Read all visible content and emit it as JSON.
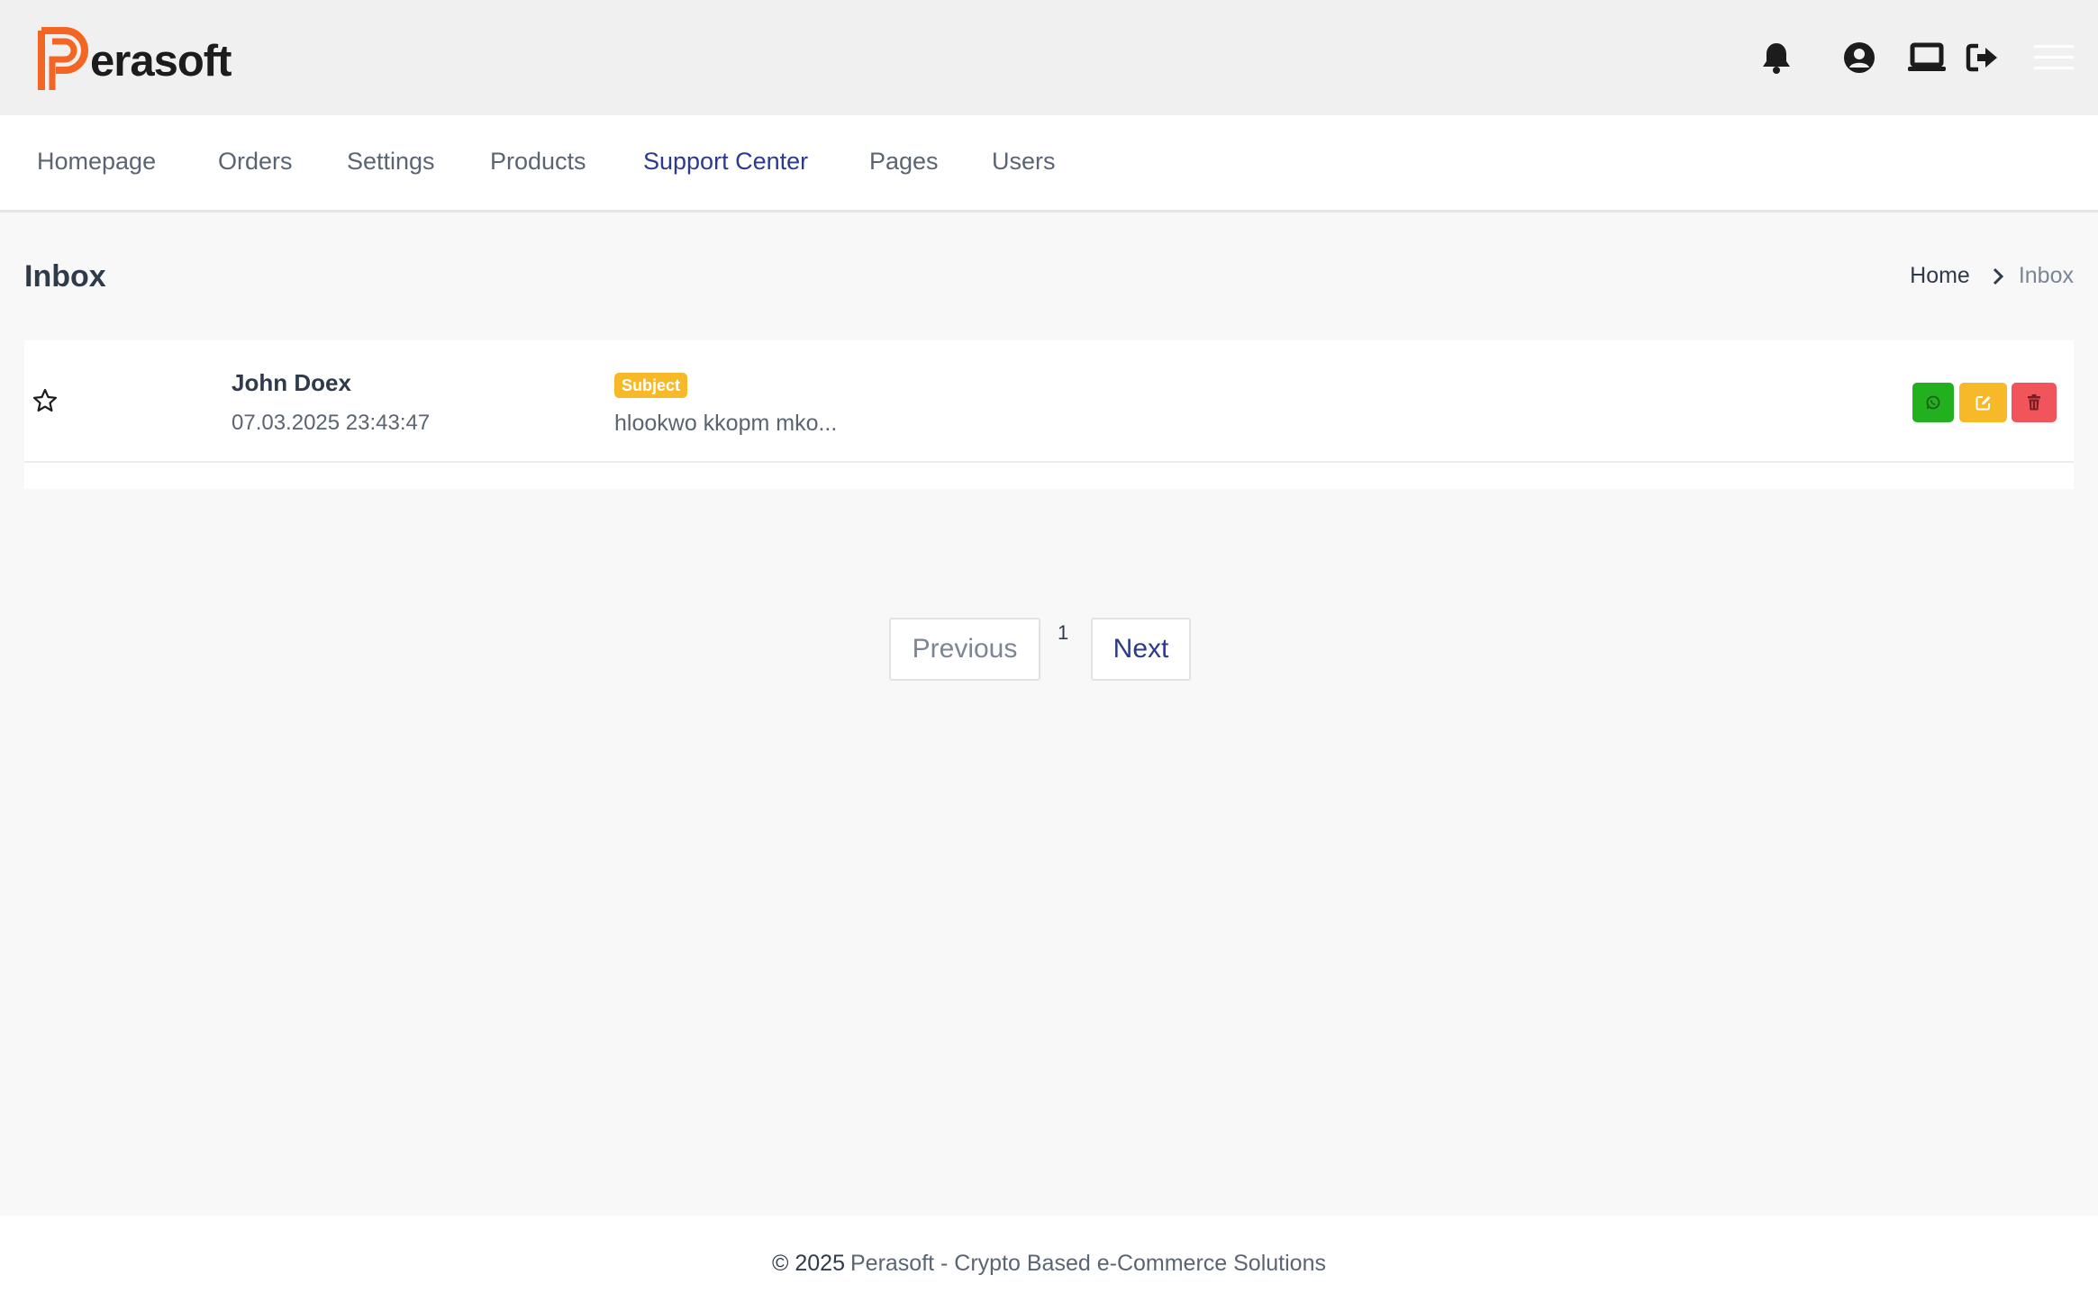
{
  "brand": {
    "name": "erasoft",
    "accent": "#f26522"
  },
  "header": {
    "icons": [
      "bell-icon",
      "user-circle-icon",
      "laptop-icon",
      "logout-icon",
      "hamburger-menu-icon"
    ]
  },
  "nav": {
    "items": [
      {
        "label": "Homepage"
      },
      {
        "label": "Orders"
      },
      {
        "label": "Settings"
      },
      {
        "label": "Products"
      },
      {
        "label": "Support Center",
        "active": true
      },
      {
        "label": "Pages"
      },
      {
        "label": "Users"
      }
    ]
  },
  "page": {
    "title": "Inbox",
    "breadcrumb": {
      "home": "Home",
      "current": "Inbox"
    }
  },
  "inbox": {
    "rows": [
      {
        "sender": "John Doex",
        "date": "07.03.2025 23:43:47",
        "badge": "Subject",
        "snippet": "hlookwo kkopm mko..."
      }
    ],
    "actions": {
      "whatsapp_color": "#22b01e",
      "edit_color": "#f7b928",
      "delete_color": "#f2545b"
    }
  },
  "pagination": {
    "previous": "Previous",
    "page": "1",
    "next": "Next"
  },
  "footer": {
    "copyright": "© 2025",
    "text": "Perasoft - Crypto Based e-Commerce Solutions"
  }
}
